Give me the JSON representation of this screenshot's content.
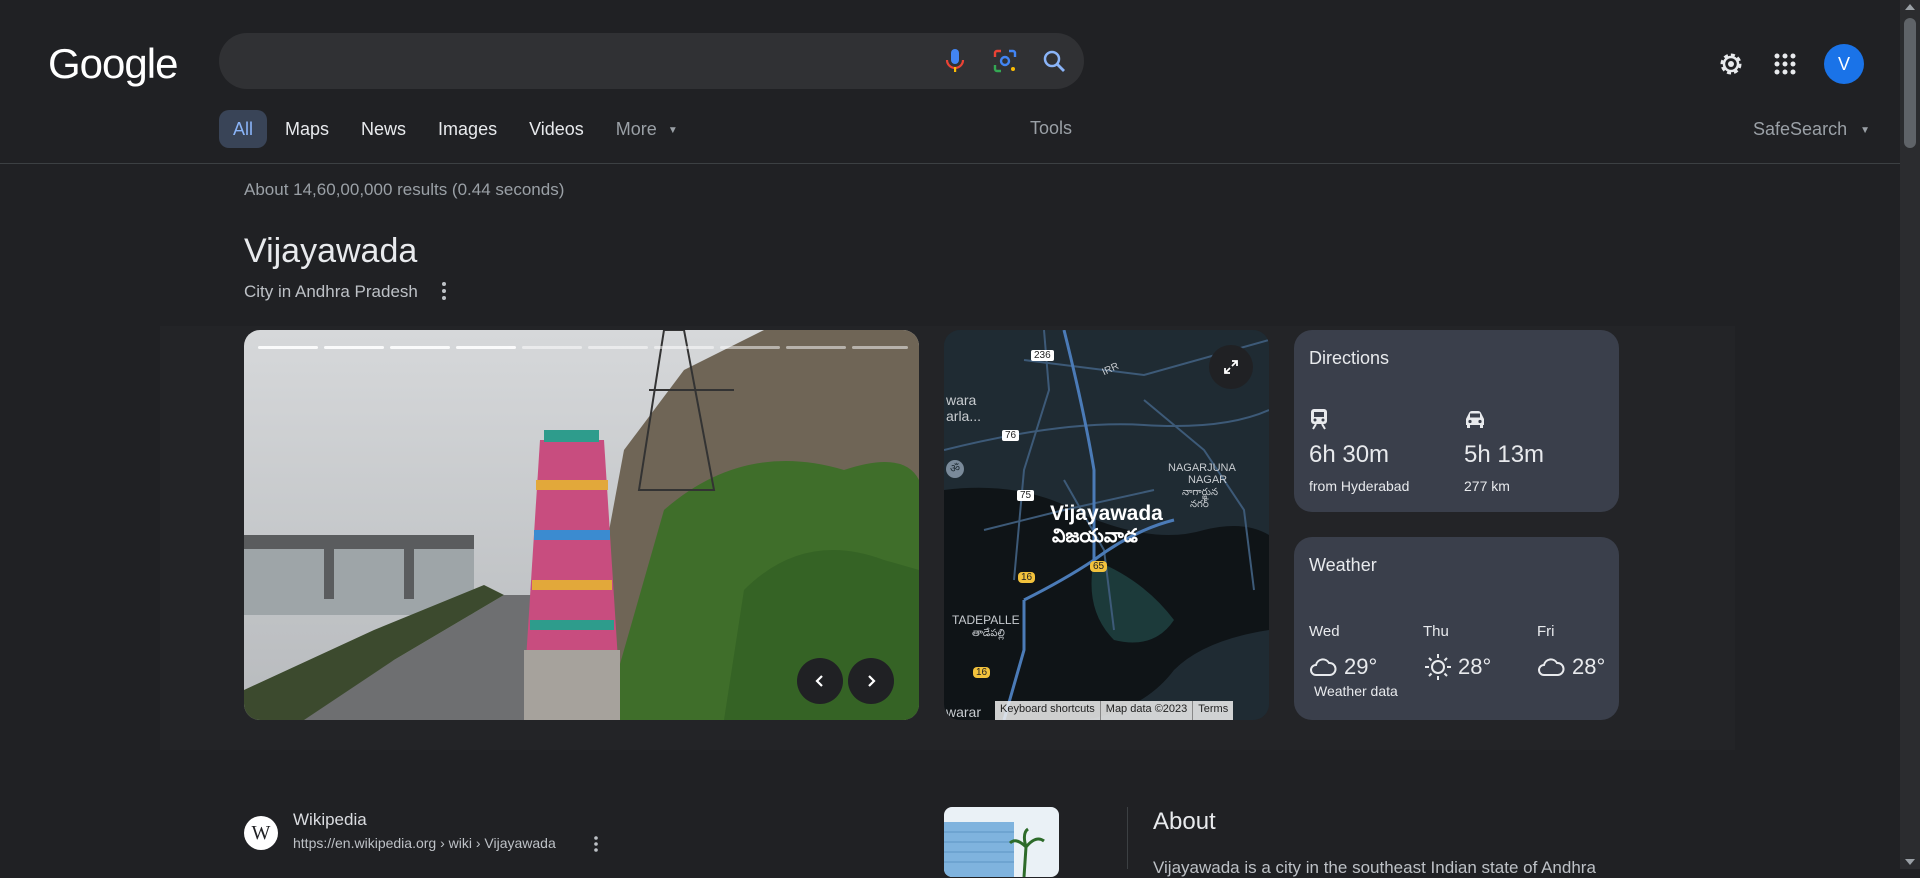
{
  "logo": "Google",
  "search": {
    "value": "",
    "placeholder": ""
  },
  "header": {
    "avatar_letter": "V"
  },
  "tabs": [
    {
      "label": "All"
    },
    {
      "label": "Maps"
    },
    {
      "label": "News"
    },
    {
      "label": "Images"
    },
    {
      "label": "Videos"
    },
    {
      "label": "More"
    }
  ],
  "tools_label": "Tools",
  "safesearch_label": "SafeSearch",
  "results_count": "About 14,60,00,000 results (0.44 seconds)",
  "knowledge_panel": {
    "title": "Vijayawada",
    "subtitle": "City in Andhra Pradesh"
  },
  "map": {
    "city_label": "Vijayawada",
    "city_label_te": "విజయవాడ",
    "locality_1": "NAGARJUNA",
    "locality_1b": "NAGAR",
    "locality_1_te": "నాగార్జున",
    "locality_1b_te": "నగర్",
    "locality_2": "TADEPALLE",
    "locality_2_te": "తాడేపల్లి",
    "partial_label_1": "wara",
    "partial_label_2": "arla...",
    "partial_label_bottom": "warar",
    "road_labels": [
      "236",
      "IRR",
      "76",
      "75",
      "65",
      "16",
      "16"
    ],
    "footer": [
      "Keyboard shortcuts",
      "Map data ©2023",
      "Terms"
    ]
  },
  "directions": {
    "title": "Directions",
    "transit": {
      "time": "6h 30m",
      "detail": "from Hyderabad"
    },
    "drive": {
      "time": "5h 13m",
      "detail": "277 km"
    }
  },
  "weather": {
    "title": "Weather",
    "days": [
      {
        "day": "Wed",
        "temp": "29°",
        "icon": "cloud-icon"
      },
      {
        "day": "Thu",
        "temp": "28°",
        "icon": "sun-icon"
      },
      {
        "day": "Fri",
        "temp": "28°",
        "icon": "cloud-icon"
      }
    ],
    "footer": "Weather data"
  },
  "wiki": {
    "logo_letter": "W",
    "name": "Wikipedia",
    "url": "https://en.wikipedia.org › wiki › Vijayawada"
  },
  "about": {
    "title": "About",
    "text": "Vijayawada is a city in the southeast Indian state of Andhra"
  },
  "colors": {
    "background": "#202124",
    "accent": "#8ab4f8",
    "card": "#3a3f4b",
    "avatar": "#1a73e8"
  }
}
